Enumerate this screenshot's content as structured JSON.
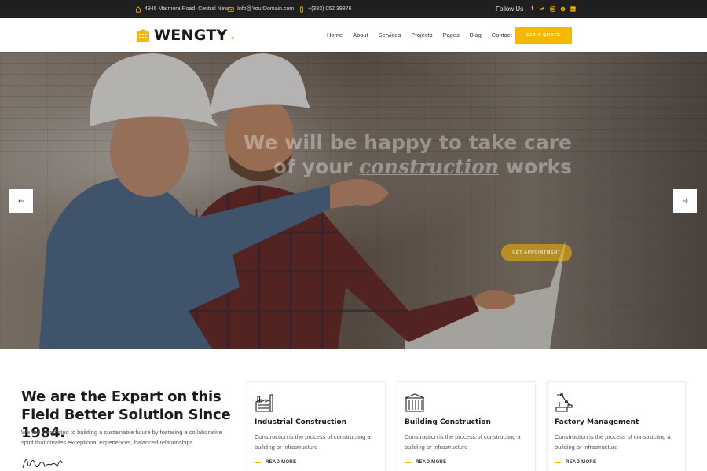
{
  "topbar": {
    "address": "4946 Marmora Road, Central New",
    "email": "Info@YourDomain.com",
    "phone": "+(333) 052 39876",
    "follow_label": "Follow Us",
    "socials": [
      "facebook-icon",
      "twitter-icon",
      "instagram-icon",
      "pinterest-icon",
      "linkedin-icon"
    ]
  },
  "header": {
    "logo_text": "WENGTY",
    "logo_dot": ".",
    "nav": [
      "Home",
      "About",
      "Services",
      "Projects",
      "Pages",
      "Blog",
      "Contact"
    ],
    "cta": "GET A QUOTE"
  },
  "hero": {
    "title_line1": "We will be happy to take care",
    "title_line2_pre": "of your",
    "title_line2_accent": "construction",
    "title_line2_post": "works",
    "button": "GET APPOINTMENT",
    "prev_icon": "arrow-left-icon",
    "next_icon": "arrow-right-icon"
  },
  "about": {
    "title": "We are the Expart on this Field Better Solution Since 1984.",
    "text": "We are committed to building a sustainable future by fostering a collaborative spirit that creates exceptional experiences, balanced relationships."
  },
  "services": [
    {
      "icon": "factory-icon",
      "title": "Industrial Construction",
      "desc": "Construction is the process of constructing a building or infrastructure",
      "more": "READ MORE"
    },
    {
      "icon": "building-icon",
      "title": "Building Construction",
      "desc": "Construction is the process of constructing a building or infrastructure",
      "more": "READ MORE"
    },
    {
      "icon": "crane-robot-icon",
      "title": "Factory Management",
      "desc": "Construction is the process of constructing a building or infrastructure",
      "more": "READ MORE"
    }
  ],
  "colors": {
    "accent": "#f5b800",
    "topbar": "#1f1f1f",
    "text_dark": "#1a1a1a"
  }
}
